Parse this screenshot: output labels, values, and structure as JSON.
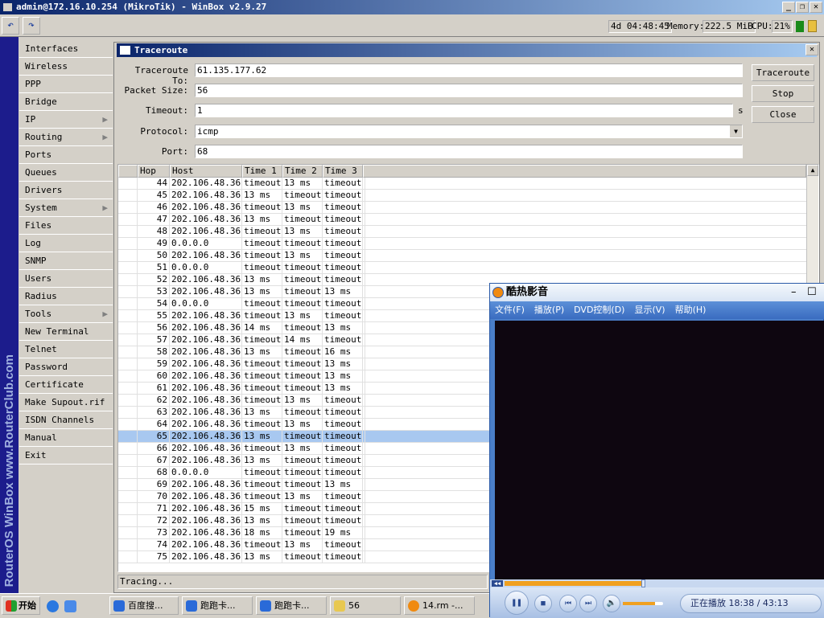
{
  "window": {
    "title": "admin@172.16.10.254 (MikroTik) - WinBox v2.9.27"
  },
  "toolbar": {
    "undo_icon": "undo-icon",
    "redo_icon": "redo-icon",
    "uptime": "4d 04:48:45",
    "memory_label": "Memory:",
    "memory": "222.5 MiB",
    "cpu_label": "CPU:",
    "cpu": "21%",
    "lock_icon": "lock-icon"
  },
  "sidebar": {
    "brand": "RouterOS WinBox   www.RouterClub.com",
    "items": [
      {
        "label": "Interfaces"
      },
      {
        "label": "Wireless"
      },
      {
        "label": "PPP"
      },
      {
        "label": "Bridge"
      },
      {
        "label": "IP",
        "sub": true
      },
      {
        "label": "Routing",
        "sub": true
      },
      {
        "label": "Ports"
      },
      {
        "label": "Queues"
      },
      {
        "label": "Drivers"
      },
      {
        "label": "System",
        "sub": true
      },
      {
        "label": "Files"
      },
      {
        "label": "Log"
      },
      {
        "label": "SNMP"
      },
      {
        "label": "Users"
      },
      {
        "label": "Radius"
      },
      {
        "label": "Tools",
        "sub": true
      },
      {
        "label": "New Terminal"
      },
      {
        "label": "Telnet"
      },
      {
        "label": "Password"
      },
      {
        "label": "Certificate"
      },
      {
        "label": "Make Supout.rif"
      },
      {
        "label": "ISDN Channels"
      },
      {
        "label": "Manual"
      },
      {
        "label": "Exit"
      }
    ]
  },
  "traceroute": {
    "title": "Traceroute",
    "fields": {
      "to_label": "Traceroute To:",
      "to": "61.135.177.62",
      "size_label": "Packet Size:",
      "size": "56",
      "timeout_label": "Timeout:",
      "timeout": "1",
      "timeout_unit": "s",
      "protocol_label": "Protocol:",
      "protocol": "icmp",
      "port_label": "Port:",
      "port": "68"
    },
    "buttons": {
      "traceroute": "Traceroute",
      "stop": "Stop",
      "close": "Close"
    },
    "columns": [
      "Hop",
      "Host",
      "Time 1",
      "Time 2",
      "Time 3"
    ],
    "selected_hop": "65",
    "rows": [
      [
        "44",
        "202.106.48.36",
        "timeout",
        "13 ms",
        "timeout"
      ],
      [
        "45",
        "202.106.48.36",
        "13 ms",
        "timeout",
        "timeout"
      ],
      [
        "46",
        "202.106.48.36",
        "timeout",
        "13 ms",
        "timeout"
      ],
      [
        "47",
        "202.106.48.36",
        "13 ms",
        "timeout",
        "timeout"
      ],
      [
        "48",
        "202.106.48.36",
        "timeout",
        "13 ms",
        "timeout"
      ],
      [
        "49",
        "0.0.0.0",
        "timeout",
        "timeout",
        "timeout"
      ],
      [
        "50",
        "202.106.48.36",
        "timeout",
        "13 ms",
        "timeout"
      ],
      [
        "51",
        "0.0.0.0",
        "timeout",
        "timeout",
        "timeout"
      ],
      [
        "52",
        "202.106.48.36",
        "13 ms",
        "timeout",
        "timeout"
      ],
      [
        "53",
        "202.106.48.36",
        "13 ms",
        "timeout",
        "13 ms"
      ],
      [
        "54",
        "0.0.0.0",
        "timeout",
        "timeout",
        "timeout"
      ],
      [
        "55",
        "202.106.48.36",
        "timeout",
        "13 ms",
        "timeout"
      ],
      [
        "56",
        "202.106.48.36",
        "14 ms",
        "timeout",
        "13 ms"
      ],
      [
        "57",
        "202.106.48.36",
        "timeout",
        "14 ms",
        "timeout"
      ],
      [
        "58",
        "202.106.48.36",
        "13 ms",
        "timeout",
        "16 ms"
      ],
      [
        "59",
        "202.106.48.36",
        "timeout",
        "timeout",
        "13 ms"
      ],
      [
        "60",
        "202.106.48.36",
        "timeout",
        "timeout",
        "13 ms"
      ],
      [
        "61",
        "202.106.48.36",
        "timeout",
        "timeout",
        "13 ms"
      ],
      [
        "62",
        "202.106.48.36",
        "timeout",
        "13 ms",
        "timeout"
      ],
      [
        "63",
        "202.106.48.36",
        "13 ms",
        "timeout",
        "timeout"
      ],
      [
        "64",
        "202.106.48.36",
        "timeout",
        "13 ms",
        "timeout"
      ],
      [
        "65",
        "202.106.48.36",
        "13 ms",
        "timeout",
        "timeout"
      ],
      [
        "66",
        "202.106.48.36",
        "timeout",
        "13 ms",
        "timeout"
      ],
      [
        "67",
        "202.106.48.36",
        "13 ms",
        "timeout",
        "timeout"
      ],
      [
        "68",
        "0.0.0.0",
        "timeout",
        "timeout",
        "timeout"
      ],
      [
        "69",
        "202.106.48.36",
        "timeout",
        "timeout",
        "13 ms"
      ],
      [
        "70",
        "202.106.48.36",
        "timeout",
        "13 ms",
        "timeout"
      ],
      [
        "71",
        "202.106.48.36",
        "15 ms",
        "timeout",
        "timeout"
      ],
      [
        "72",
        "202.106.48.36",
        "13 ms",
        "timeout",
        "timeout"
      ],
      [
        "73",
        "202.106.48.36",
        "18 ms",
        "timeout",
        "19 ms"
      ],
      [
        "74",
        "202.106.48.36",
        "timeout",
        "13 ms",
        "timeout"
      ],
      [
        "75",
        "202.106.48.36",
        "13 ms",
        "timeout",
        "timeout"
      ]
    ],
    "status": "Tracing..."
  },
  "player": {
    "title": "酷热影音",
    "menu": [
      "文件(F)",
      "播放(P)",
      "DVD控制(D)",
      "显示(V)",
      "帮助(H)"
    ],
    "status": "正在播放",
    "time": "18:38 / 43:13",
    "progress": 0.43,
    "volume": 0.8
  },
  "taskbar": {
    "start": "开始",
    "tasks": [
      "百度搜...",
      "跑跑卡...",
      "跑跑卡...",
      "56",
      "14.rm -..."
    ]
  }
}
